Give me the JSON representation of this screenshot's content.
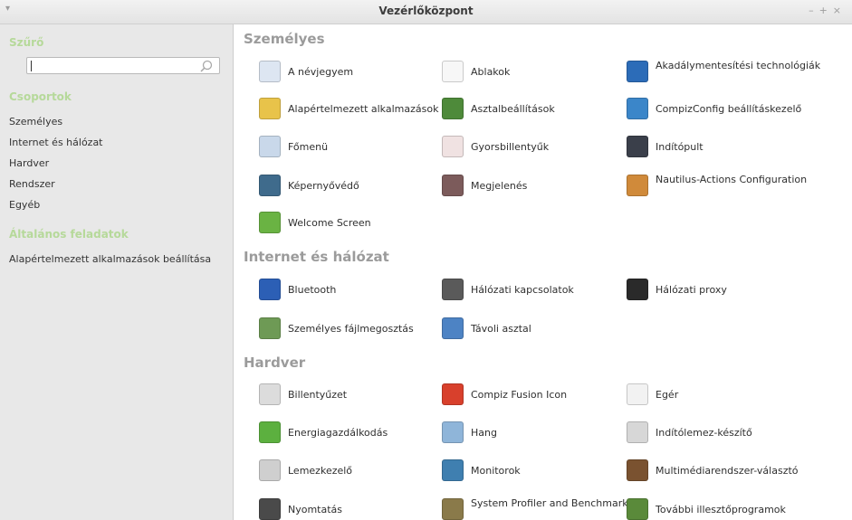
{
  "window": {
    "title": "Vezérlőközpont",
    "menu_glyph": "▾",
    "controls": [
      "–",
      "+",
      "×"
    ]
  },
  "sidebar": {
    "filter_heading": "Szűrő",
    "search_value": "",
    "groups_heading": "Csoportok",
    "groups": [
      "Személyes",
      "Internet és hálózat",
      "Hardver",
      "Rendszer",
      "Egyéb"
    ],
    "tasks_heading": "Általános feladatok",
    "tasks": [
      "Alapértelmezett alkalmazások beállítása"
    ]
  },
  "sections": [
    {
      "title": "Személyes",
      "items": [
        {
          "label": "A névjegyem",
          "icon": "id-card-icon",
          "color": "#dde6f2"
        },
        {
          "label": "Ablakok",
          "icon": "window-icon",
          "color": "#f7f7f7"
        },
        {
          "label": "Akadálymentesítési technológiák",
          "icon": "accessibility-icon",
          "color": "#2c6cb8"
        },
        {
          "label": "Alapértelmezett alkalmazások",
          "icon": "star-icon",
          "color": "#e8c34a"
        },
        {
          "label": "Asztalbeállítások",
          "icon": "desktop-icon",
          "color": "#4e8a3a"
        },
        {
          "label": "CompizConfig beállításkezelő",
          "icon": "compiz-pointer-icon",
          "color": "#3b86c9"
        },
        {
          "label": "Főmenü",
          "icon": "menu-editor-icon",
          "color": "#c9d8ea"
        },
        {
          "label": "Gyorsbillentyűk",
          "icon": "keyboard-shortcut-icon",
          "color": "#f0e2e2"
        },
        {
          "label": "Indítópult",
          "icon": "startup-user-icon",
          "color": "#3a3f4a"
        },
        {
          "label": "Képernyővédő",
          "icon": "screensaver-icon",
          "color": "#3f6b8c"
        },
        {
          "label": "Megjelenés",
          "icon": "appearance-tie-icon",
          "color": "#7c5b5b"
        },
        {
          "label": "Nautilus-Actions Configuration",
          "icon": "nautilus-actions-icon",
          "color": "#d08a3a"
        },
        {
          "label": "Welcome Screen",
          "icon": "mint-logo-icon",
          "color": "#6ab343"
        }
      ]
    },
    {
      "title": "Internet és hálózat",
      "items": [
        {
          "label": "Bluetooth",
          "icon": "bluetooth-icon",
          "color": "#2c5fb5"
        },
        {
          "label": "Hálózati kapcsolatok",
          "icon": "network-connections-icon",
          "color": "#5a5a5a"
        },
        {
          "label": "Hálózati proxy",
          "icon": "network-proxy-icon",
          "color": "#2a2a2a"
        },
        {
          "label": "Személyes fájlmegosztás",
          "icon": "file-sharing-icon",
          "color": "#6e9a55"
        },
        {
          "label": "Távoli asztal",
          "icon": "remote-desktop-icon",
          "color": "#4d83c4"
        }
      ]
    },
    {
      "title": "Hardver",
      "items": [
        {
          "label": "Billentyűzet",
          "icon": "keyboard-icon",
          "color": "#dcdcdc"
        },
        {
          "label": "Compiz Fusion Icon",
          "icon": "compiz-fusion-icon",
          "color": "#d8402c"
        },
        {
          "label": "Egér",
          "icon": "mouse-icon",
          "color": "#f2f2f2"
        },
        {
          "label": "Energiagazdálkodás",
          "icon": "battery-icon",
          "color": "#5cb03f"
        },
        {
          "label": "Hang",
          "icon": "speaker-icon",
          "color": "#8fb5d9"
        },
        {
          "label": "Indítólemez-készítő",
          "icon": "usb-creator-icon",
          "color": "#d7d7d7"
        },
        {
          "label": "Lemezkezelő",
          "icon": "disk-utility-icon",
          "color": "#cfcfcf"
        },
        {
          "label": "Monitorok",
          "icon": "monitor-icon",
          "color": "#3f7fb0"
        },
        {
          "label": "Multimédiarendszer-választó",
          "icon": "multimedia-icon",
          "color": "#7a5230"
        },
        {
          "label": "Nyomtatás",
          "icon": "printer-icon",
          "color": "#4a4a4a"
        },
        {
          "label": "System Profiler and Benchmark",
          "icon": "system-profiler-icon",
          "color": "#8a7a4a"
        },
        {
          "label": "További illesztőprogramok",
          "icon": "additional-drivers-icon",
          "color": "#5a8a3a"
        }
      ]
    }
  ]
}
